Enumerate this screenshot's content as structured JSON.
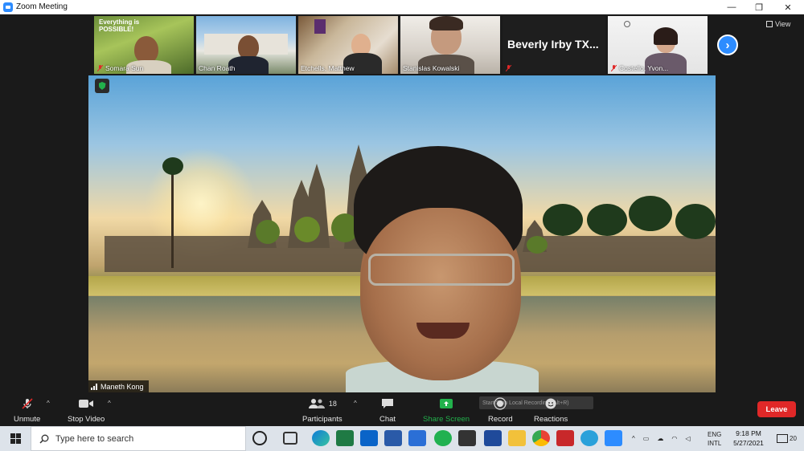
{
  "window": {
    "title": "Zoom Meeting",
    "controls": [
      "—",
      "❐",
      "✕"
    ]
  },
  "gallery": {
    "thumbnails": [
      {
        "name": "Somara Sun",
        "caption_line1": "Everything is",
        "caption_line2": "POSSIBLE!",
        "muted": true
      },
      {
        "name": "Chan Roath",
        "muted": false
      },
      {
        "name": "Etchells, Matthew",
        "muted": false
      },
      {
        "name": "Stanislas Kowalski",
        "muted": false
      },
      {
        "name": "Beverly Irby TX...",
        "muted": true
      },
      {
        "name": "Costello, Yvon...",
        "muted": true
      }
    ],
    "view_label": "View"
  },
  "main_speaker": {
    "name": "Maneth Kong"
  },
  "toolbar": {
    "unmute": "Unmute",
    "stop_video": "Stop Video",
    "participants": "Participants",
    "participants_count": "18",
    "chat": "Chat",
    "share_screen": "Share Screen",
    "record": "Record",
    "record_tip": "Start/Stop Local Recording (Alt+R)",
    "reactions": "Reactions",
    "leave": "Leave"
  },
  "taskbar": {
    "search_placeholder": "Type here to search",
    "lang1": "ENG",
    "lang2": "INTL",
    "time": "9:18 PM",
    "date": "5/27/2021",
    "notifications": "20"
  },
  "colors": {
    "zoom_blue": "#2d8cff",
    "leave_red": "#e02828",
    "share_green": "#22b14c"
  }
}
